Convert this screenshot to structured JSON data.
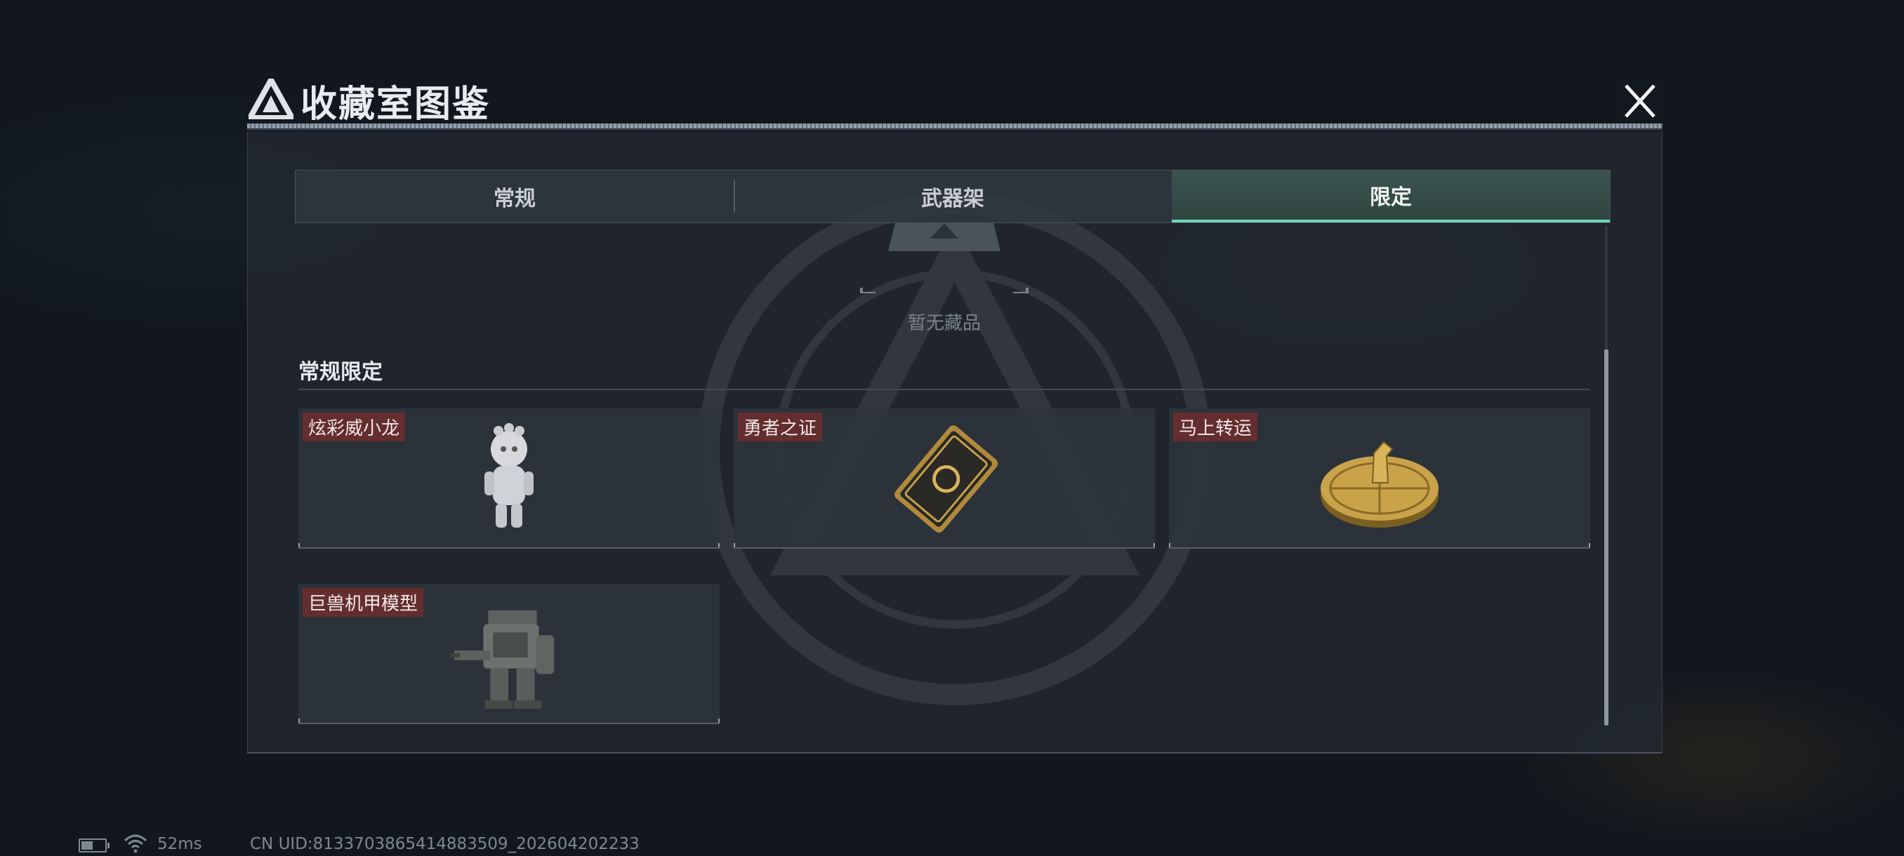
{
  "header": {
    "title": "收藏室图鉴",
    "logo_icon": "triangle-logo-icon",
    "close_icon": "close-icon"
  },
  "tabs": [
    {
      "label": "常规",
      "active": false
    },
    {
      "label": "武器架",
      "active": false
    },
    {
      "label": "限定",
      "active": true
    }
  ],
  "empty_state": {
    "text": "暂无藏品"
  },
  "section": {
    "title": "常规限定",
    "items": [
      {
        "label": "炫彩威小龙",
        "art": "dragon-figurine"
      },
      {
        "label": "勇者之证",
        "art": "gold-card"
      },
      {
        "label": "马上转运",
        "art": "horse-turntable"
      },
      {
        "label": "巨兽机甲模型",
        "art": "mech-model"
      }
    ]
  },
  "status": {
    "battery_level": 0.5,
    "ping": "52ms",
    "uid": "CN UID:8133703865414883509_202604202233"
  },
  "colors": {
    "accent": "#6fd6b8",
    "label_bg": "#6e2d2d",
    "panel_bg": "#21272e"
  }
}
